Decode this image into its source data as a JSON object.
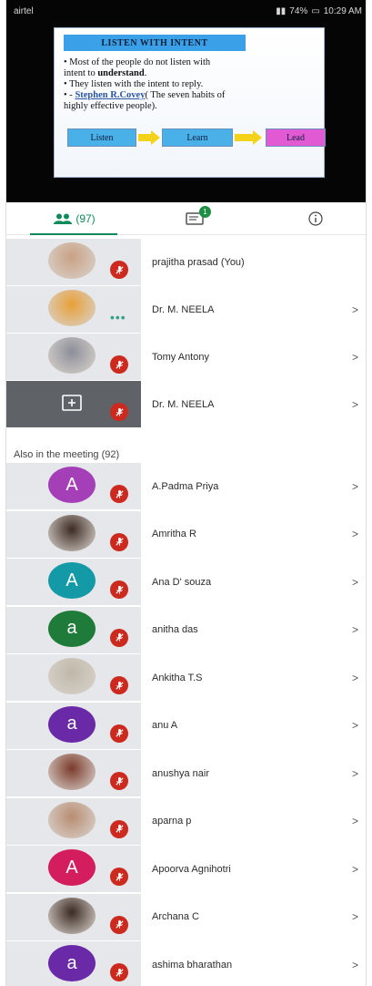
{
  "statusbar": {
    "carrier": "airtel",
    "right_text": "74%",
    "time": "10:29 AM"
  },
  "slide": {
    "title": "LISTEN WITH INTENT",
    "bullet1_line1": "• Most of the people do not listen with",
    "bullet1_line2_pre": "intent to ",
    "bullet1_line2_bold": "understand",
    "bullet1_line2_post": ".",
    "bullet2": "• They listen with the intent to reply.",
    "bullet3_pre": "• - ",
    "bullet3_author": "Stephen R.Covey",
    "bullet3_post": "( The seven habits of",
    "bullet3_line2": "highly effective people).",
    "box1": "Listen",
    "box2": "Learn",
    "box3": "Lead"
  },
  "tabs": {
    "people_count": "(97)",
    "chat_badge": "1"
  },
  "participants_top": [
    {
      "name": "prajitha prasad (You)",
      "avatar_type": "photo",
      "avatar_color": "#c9a184",
      "status": "muted",
      "chevron": ""
    },
    {
      "name": "Dr. M. NEELA",
      "avatar_type": "photo",
      "avatar_color": "#e8a037",
      "status": "speaking",
      "chevron": ">"
    },
    {
      "name": "Tomy Antony",
      "avatar_type": "photo",
      "avatar_color": "#8c8f99",
      "status": "muted",
      "chevron": ">"
    },
    {
      "name": "Dr. M. NEELA",
      "avatar_type": "presenting",
      "avatar_color": "#5f6368",
      "status": "muted",
      "chevron": ">"
    }
  ],
  "section_header": "Also in the meeting (92)",
  "participants_more": [
    {
      "name": "A.Padma Priya",
      "avatar_type": "letter",
      "letter": "A",
      "avatar_color": "#a43fb8",
      "chevron": ">"
    },
    {
      "name": "Amritha R",
      "avatar_type": "photo",
      "avatar_color": "#3d2b24",
      "chevron": ">"
    },
    {
      "name": "Ana D' souza",
      "avatar_type": "letter",
      "letter": "A",
      "avatar_color": "#149aa6",
      "chevron": ">"
    },
    {
      "name": "anitha das",
      "avatar_type": "letter",
      "letter": "a",
      "avatar_color": "#1e7b3a",
      "chevron": ">"
    },
    {
      "name": "Ankitha T.S",
      "avatar_type": "photo",
      "avatar_color": "#bfb8a8",
      "chevron": ">"
    },
    {
      "name": "anu A",
      "avatar_type": "letter",
      "letter": "a",
      "avatar_color": "#6a2aa8",
      "chevron": ">"
    },
    {
      "name": "anushya nair",
      "avatar_type": "photo",
      "avatar_color": "#7b3a2a",
      "chevron": ">"
    },
    {
      "name": "aparna p",
      "avatar_type": "photo",
      "avatar_color": "#b88d72",
      "chevron": ">"
    },
    {
      "name": "Apoorva Agnihotri",
      "avatar_type": "letter",
      "letter": "A",
      "avatar_color": "#d41d5c",
      "chevron": ">"
    },
    {
      "name": "Archana C",
      "avatar_type": "photo",
      "avatar_color": "#3a2a22",
      "chevron": ">"
    },
    {
      "name": "ashima bharathan",
      "avatar_type": "letter",
      "letter": "a",
      "avatar_color": "#6a2aa8",
      "chevron": ">"
    }
  ]
}
